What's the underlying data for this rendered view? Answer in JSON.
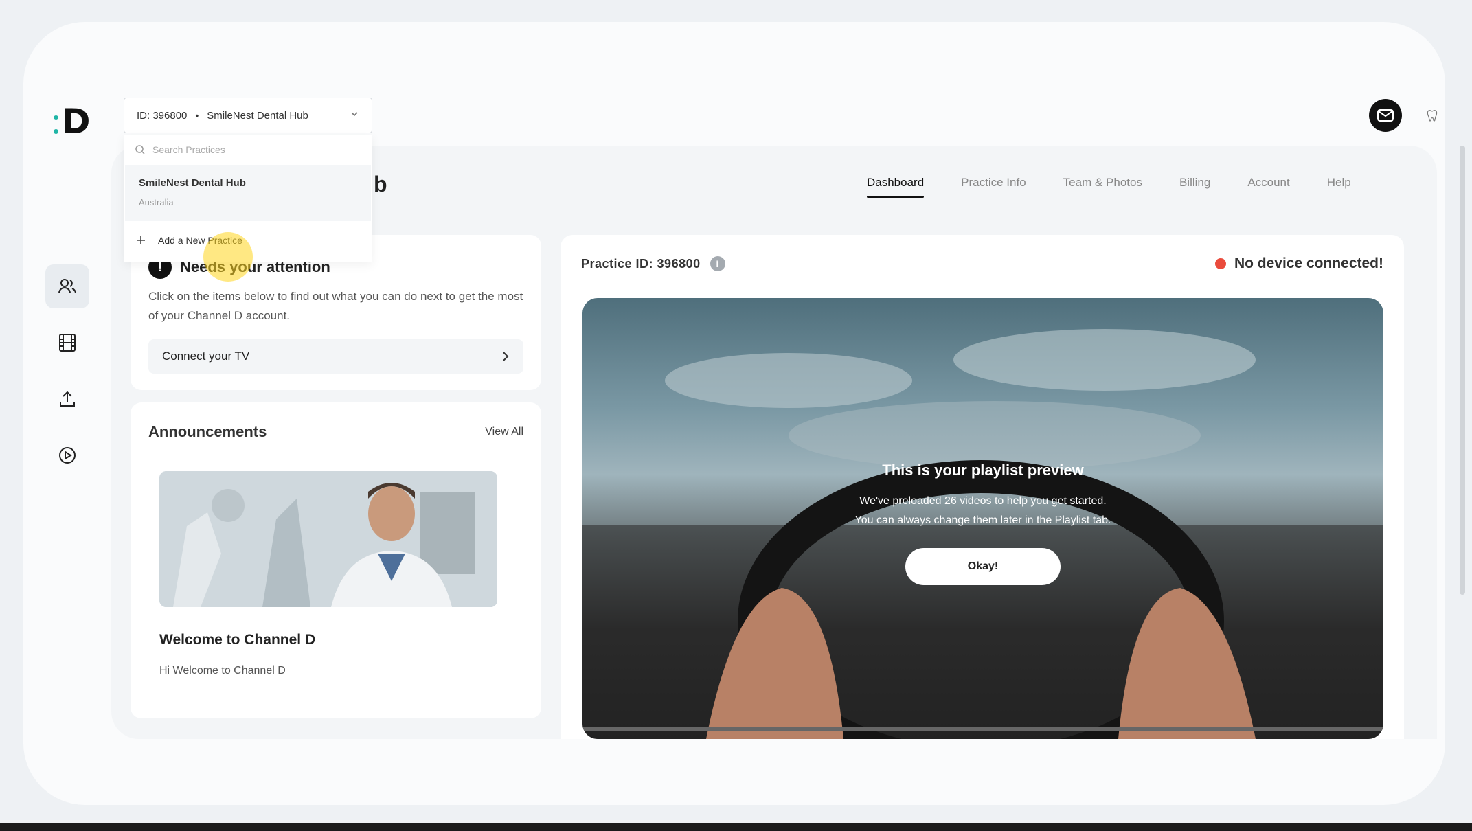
{
  "header": {
    "practice_selector": {
      "id_label": "ID: 396800",
      "separator": "•",
      "name": "SmileNest Dental Hub"
    },
    "page_title_tail": "b"
  },
  "dropdown": {
    "search_placeholder": "Search Practices",
    "items": [
      {
        "name": "SmileNest Dental Hub",
        "location": "Australia"
      }
    ],
    "add_label": "Add a New Practice"
  },
  "tabs": [
    {
      "label": "Dashboard",
      "active": true
    },
    {
      "label": "Practice Info"
    },
    {
      "label": "Team & Photos"
    },
    {
      "label": "Billing"
    },
    {
      "label": "Account"
    },
    {
      "label": "Help"
    }
  ],
  "sidebar": {
    "icons": [
      "users-icon",
      "film-icon",
      "upload-icon",
      "play-icon"
    ]
  },
  "attention": {
    "badge": "!",
    "title": "Needs your attention",
    "description": "Click on the items below to find out what you can do next to get the most of your Channel D account.",
    "action_label": "Connect your TV"
  },
  "announcements": {
    "heading": "Announcements",
    "view_all": "View All",
    "item": {
      "title": "Welcome to Channel D",
      "subtitle": "Hi Welcome to Channel D"
    }
  },
  "preview": {
    "practice_id": "Practice ID: 396800",
    "device_status": "No device connected!",
    "title": "This is your playlist preview",
    "line1": "We've preloaded 26 videos to help you get started.",
    "line2": "You can always change them later in the Playlist tab.",
    "button": "Okay!"
  },
  "colors": {
    "accent": "#1fb5a6",
    "status_red": "#ea4b3c",
    "highlight": "#ffd61e"
  }
}
